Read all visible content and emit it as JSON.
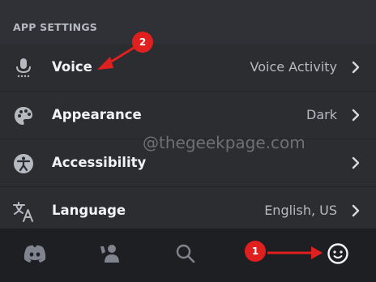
{
  "section": {
    "title": "APP SETTINGS"
  },
  "rows": [
    {
      "label": "Voice",
      "value": "Voice Activity",
      "icon": "microphone-icon"
    },
    {
      "label": "Appearance",
      "value": "Dark",
      "icon": "palette-icon"
    },
    {
      "label": "Accessibility",
      "value": "",
      "icon": "accessibility-icon"
    },
    {
      "label": "Language",
      "value": "English, US",
      "icon": "translate-icon"
    }
  ],
  "watermark": "@thegeekpage.com",
  "nav": {
    "items": [
      "discord-home-icon",
      "friends-icon",
      "search-icon",
      "profile-icon"
    ]
  },
  "annotations": {
    "badge1": "1",
    "badge2": "2"
  },
  "colors": {
    "background": "#303136",
    "row": "#2b2d31",
    "nav": "#1e1f22",
    "annotation": "#e0201f"
  }
}
